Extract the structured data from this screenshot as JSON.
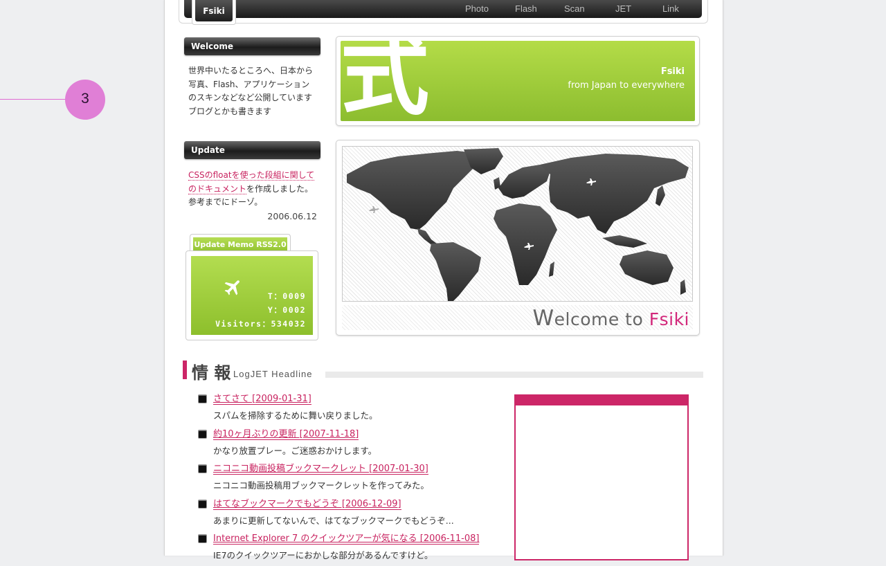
{
  "annotation": {
    "marker_label": "3"
  },
  "nav": {
    "brand": "Fsiki",
    "items": [
      "Photo",
      "Flash",
      "Scan",
      "JET",
      "Link"
    ]
  },
  "sidebar": {
    "welcome": {
      "heading": "Welcome",
      "text": "世界中いたるところへ、日本から写真、Flash、アプリケーションのスキンなどなど公開しています ブログとかも書きます"
    },
    "update": {
      "heading": "Update",
      "link_text": "CSSのfloatを使った段組に関してのドキュメント",
      "text_rest": "を作成しました。参考までにドーゾ。",
      "date": "2006.06.12"
    },
    "visitors": {
      "tab_label": "Update Memo RSS2.0",
      "t_label": "T：",
      "t_value": "0009",
      "y_label": "Y：",
      "y_value": "0002",
      "visitors_label": "Visitors：",
      "visitors_value": "534032"
    }
  },
  "banner": {
    "kanji": "式",
    "title": "Fsiki",
    "subtitle": "from Japan to everywhere"
  },
  "map": {
    "welcome_prefix": "W",
    "welcome_rest": "elcome to ",
    "welcome_brand": "Fsiki"
  },
  "headline": {
    "title": "情 報",
    "subtitle": "LogJET Headline",
    "items": [
      {
        "title": "さてさて [2009-01-31]",
        "desc": "スパムを掃除するために舞い戻りました。"
      },
      {
        "title": "約10ヶ月ぶりの更新 [2007-11-18]",
        "desc": "かなり放置プレー。ご迷惑おかけします。"
      },
      {
        "title": "ニコニコ動画投稿ブックマークレット [2007-01-30]",
        "desc": "ニコニコ動画投稿用ブックマークレットを作ってみた。"
      },
      {
        "title": "はてなブックマークでもどうぞ [2006-12-09]",
        "desc": "あまりに更新してないんで、はてなブックマークでもどうぞ..."
      },
      {
        "title": "Internet Explorer 7 のクイックツアーが気になる [2006-11-08]",
        "desc": "IE7のクイックツアーにおかしな部分があるんですけど。"
      }
    ]
  },
  "colors": {
    "accent": "#cc2667",
    "green": "#9fcd3c",
    "dark": "#1e1e1e"
  }
}
